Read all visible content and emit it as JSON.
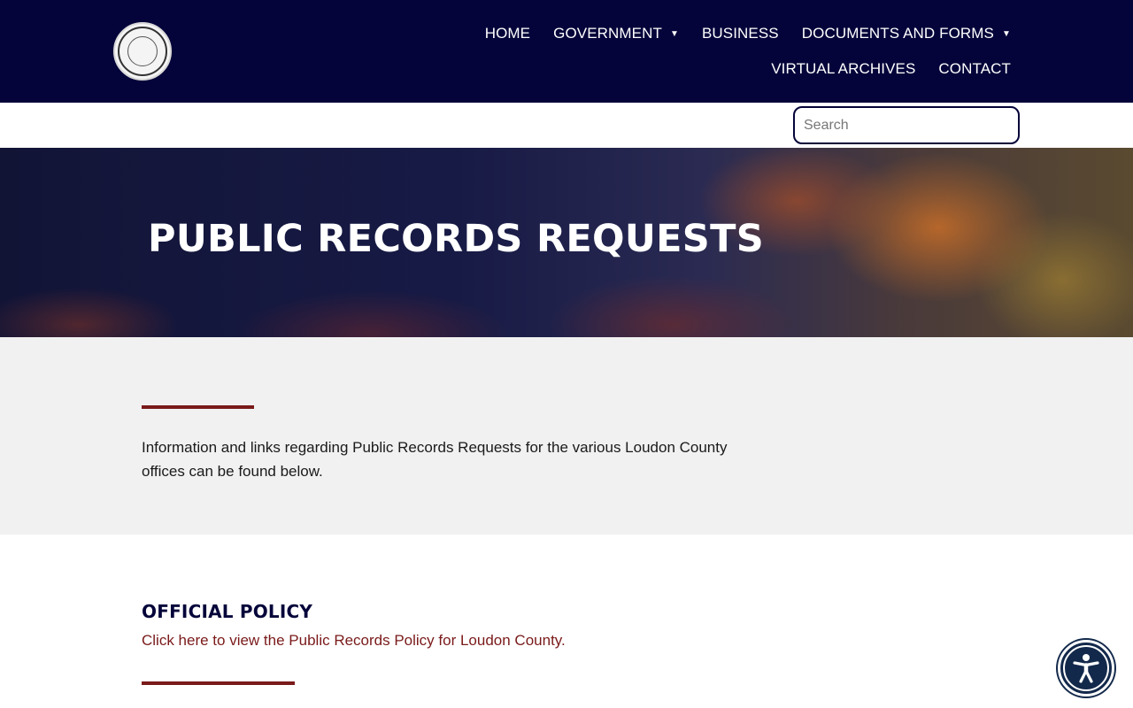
{
  "header": {
    "logo": {
      "icon": "county-seal-icon"
    },
    "nav": {
      "row1": [
        {
          "label": "HOME",
          "dropdown": false
        },
        {
          "label": "GOVERNMENT",
          "dropdown": true
        },
        {
          "label": "BUSINESS",
          "dropdown": false
        },
        {
          "label": "DOCUMENTS AND FORMS",
          "dropdown": true
        }
      ],
      "row2": [
        {
          "label": "VIRTUAL ARCHIVES",
          "dropdown": false
        },
        {
          "label": "CONTACT",
          "dropdown": false
        }
      ]
    },
    "dropdown_caret": "▼"
  },
  "search": {
    "placeholder": "Search",
    "value": ""
  },
  "hero": {
    "title": "PUBLIC RECORDS REQUESTS"
  },
  "intro": {
    "text": "Information and links regarding Public Records Requests for the various Loudon County offices can be found below."
  },
  "policy": {
    "heading": "OFFICIAL POLICY",
    "link": "Click here to view the Public Records Policy for Loudon County."
  },
  "accessibility": {
    "icon": "accessibility-icon"
  },
  "colors": {
    "navy": "#04043a",
    "maroon": "#7a1a1a",
    "light_gray": "#f1f1f1",
    "a11y_blue": "#13294b"
  }
}
